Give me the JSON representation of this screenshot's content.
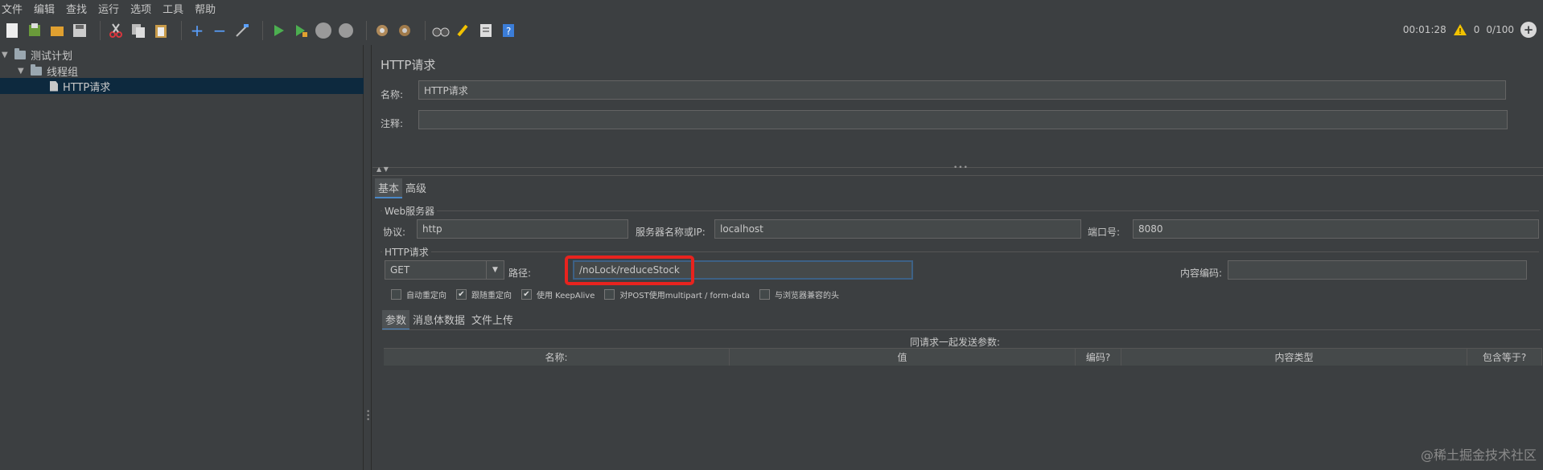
{
  "menu": [
    "文件",
    "编辑",
    "查找",
    "运行",
    "选项",
    "工具",
    "帮助"
  ],
  "toolbar": {
    "icons": [
      "new-icon",
      "templates-icon",
      "open-icon",
      "save-icon",
      "cut-icon",
      "copy-icon",
      "paste-icon",
      "expand-icon",
      "collapse-icon",
      "toggle-icon",
      "start-icon",
      "start-no-pause-icon",
      "stop-icon",
      "shutdown-icon",
      "clear-icon",
      "clear-all-icon",
      "search-icon",
      "reset-search-icon",
      "function-helper-icon",
      "help-icon"
    ],
    "timer": "00:01:28",
    "warnings": "0",
    "threads": "0/100",
    "colors": {
      "start": "#4caf50",
      "warn": "#f2c200",
      "help": "#3b7dd8",
      "cut": "#d9363e"
    }
  },
  "tree": {
    "items": [
      {
        "label": "测试计划"
      },
      {
        "label": "线程组"
      },
      {
        "label": "HTTP请求"
      }
    ]
  },
  "panel": {
    "title": "HTTP请求",
    "name_label": "名称:",
    "name_value": "HTTP请求",
    "comment_label": "注释:",
    "comment_value": "",
    "tabs": [
      "基本",
      "高级"
    ],
    "web_server": {
      "group_title": "Web服务器",
      "protocol_label": "协议:",
      "protocol_value": "http",
      "server_label": "服务器名称或IP:",
      "server_value": "localhost",
      "port_label": "端口号:",
      "port_value": "8080"
    },
    "http_request": {
      "group_title": "HTTP请求",
      "method": "GET",
      "path_label": "路径:",
      "path_value": "/noLock/reduceStock",
      "encoding_label": "内容编码:",
      "encoding_value": ""
    },
    "checkboxes": [
      {
        "label": "自动重定向",
        "checked": false
      },
      {
        "label": "跟随重定向",
        "checked": true
      },
      {
        "label": "使用 KeepAlive",
        "checked": true
      },
      {
        "label": "对POST使用multipart / form-data",
        "checked": false
      },
      {
        "label": "与浏览器兼容的头",
        "checked": false
      }
    ],
    "param_tabs": [
      "参数",
      "消息体数据",
      "文件上传"
    ],
    "params_caption": "同请求一起发送参数:",
    "columns": [
      "名称:",
      "值",
      "编码?",
      "内容类型",
      "包含等于?"
    ]
  },
  "watermark": "@稀土掘金技术社区"
}
